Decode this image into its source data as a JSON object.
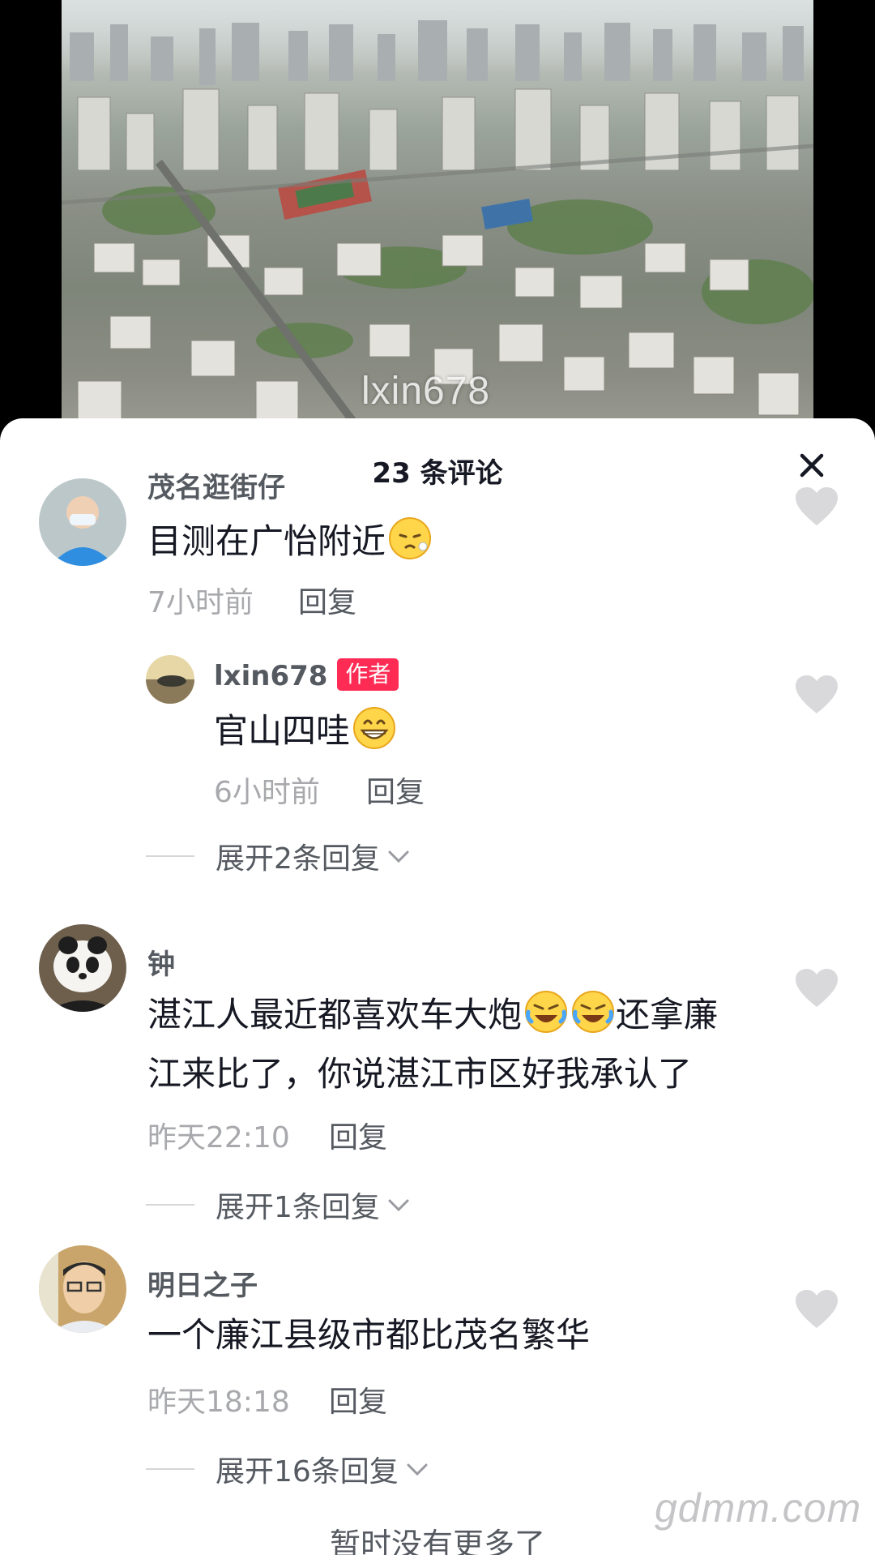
{
  "video": {
    "watermark": "lxin678"
  },
  "sheet": {
    "title": "23 条评论",
    "close_icon": "close-icon"
  },
  "comments": [
    {
      "username": "茂名逛街仔",
      "text": "目测在广怡附近",
      "emoji": "sneeze-face",
      "time": "7小时前",
      "reply_label": "回复"
    },
    {
      "username": "lxin678",
      "badge": "作者",
      "text": "官山四哇",
      "emoji": "grinning-face",
      "time": "6小时前",
      "reply_label": "回复",
      "expand_label": "展开2条回复"
    },
    {
      "username": "钟",
      "text_line1_a": "湛江人最近都喜欢车大炮",
      "emoji": "rolling-on-floor-laughing",
      "text_line1_b": "还拿廉",
      "text_line2": "江来比了，你说湛江市区好我承认了",
      "time": "昨天22:10",
      "reply_label": "回复",
      "expand_label": "展开1条回复"
    },
    {
      "username": "明日之子",
      "text": "一个廉江县级市都比茂名繁华",
      "time": "昨天18:18",
      "reply_label": "回复",
      "expand_label": "展开16条回复"
    }
  ],
  "footer": {
    "end_text": "暂时没有更多了",
    "site_watermark": "gdmm.com"
  },
  "colors": {
    "author_badge": "#fe2c55",
    "like_heart": "#d9d9db",
    "meta_text": "#a8a9ad"
  }
}
